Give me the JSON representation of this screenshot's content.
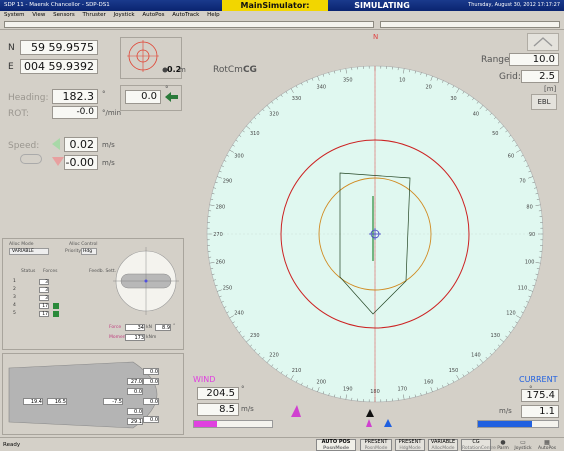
{
  "titlebar": {
    "app_title": "SDP 11 - Maersk Chancellor - SDP-DS1",
    "mode": "MainSimulator: Propulsion",
    "status": "SIMULATING",
    "datetime": "Thursday, August 30, 2012 17:17:27"
  },
  "menu": [
    "System",
    "View",
    "Sensors",
    "Thruster",
    "Joystick",
    "AutoPos",
    "AutoTrack",
    "Help"
  ],
  "position": {
    "n_label": "N",
    "n_value": "59 59.9575",
    "e_label": "E",
    "e_value": "004 59.9392",
    "offset_value": "0.2",
    "offset_unit": "m"
  },
  "heading": {
    "label": "Heading:",
    "value": "182.3",
    "unit": "°",
    "rot_label": "ROT:",
    "rot_value": "-0.0",
    "rot_unit": "°/min",
    "setpoint": "0.0",
    "setpoint_unit": "°"
  },
  "speed": {
    "label": "Speed:",
    "fwd_value": "0.02",
    "stbd_value": "-0.00",
    "unit": "m/s"
  },
  "thruster_panel": {
    "alloc_mode_label": "Alloc Mode",
    "alloc_mode_value": "VARIABLE",
    "alloc_control_label": "Alloc Control",
    "priority_label": "Priority",
    "priority_value": "Hdg",
    "status_label": "Status",
    "forces_label": "Forces",
    "fb_label": "Feedb. Sett.",
    "rows": [
      "1",
      "2",
      "3",
      "4",
      "5"
    ],
    "row_values": [
      "3",
      "3",
      "3",
      "17",
      "17"
    ],
    "force_label": "Force",
    "force_value": "34",
    "force_unit": "kN",
    "force_dir": "8.9",
    "force_dir_unit": "°",
    "moment_label": "Moment",
    "moment_value": "173",
    "moment_unit": "kNm"
  },
  "vessel_panel": {
    "readouts": [
      "19.4",
      "16.5",
      "-7.5",
      "0.0",
      "0.0",
      "0.0",
      "0.0",
      "0.0",
      "0.0",
      "29.1",
      "27.0"
    ]
  },
  "radar": {
    "rotation_label": "RotCm",
    "rotation_suffix": "CG",
    "range_label": "Range:",
    "range_value": "10.0",
    "grid_label": "Grid:",
    "grid_value": "2.5",
    "grid_unit": "[m]",
    "ebl_label": "EBL",
    "north_label": "N",
    "compass_labels": [
      "10",
      "20",
      "30",
      "40",
      "50",
      "60",
      "70",
      "80",
      "90",
      "100",
      "110",
      "120",
      "130",
      "140",
      "150",
      "160",
      "170",
      "180",
      "190",
      "200",
      "210",
      "220",
      "230",
      "240",
      "250",
      "260",
      "270",
      "280",
      "290",
      "300",
      "310",
      "320",
      "330",
      "340",
      "350"
    ]
  },
  "wind": {
    "label": "WIND",
    "dir_value": "204.5",
    "dir_unit": "°",
    "speed_value": "8.5",
    "speed_unit": "m/s",
    "color": "#e040e0"
  },
  "current": {
    "label": "CURRENT",
    "dir_value": "175.4",
    "dir_unit": "°",
    "speed_value": "1.1",
    "speed_unit": "m/s",
    "color": "#2060e0"
  },
  "statusbar": {
    "ready": "Ready",
    "modes": [
      {
        "label": "AUTO POS",
        "sub": "PosnMode"
      },
      {
        "label": "PRESENT",
        "sub": "PosnMode"
      },
      {
        "label": "PRESENT",
        "sub": "HdgMode"
      },
      {
        "label": "VARIABLE",
        "sub": "AllocMode"
      },
      {
        "label": "CG",
        "sub": "RotationCentre"
      }
    ],
    "icons": [
      "Parm",
      "Joystick",
      "AutoPos"
    ]
  },
  "colors": {
    "radar_bg": "#e0f8f0",
    "ring_outer": "#cc2222",
    "ring_inner": "#d08a20",
    "vessel": "#224422",
    "title_accent": "#f2d600"
  }
}
